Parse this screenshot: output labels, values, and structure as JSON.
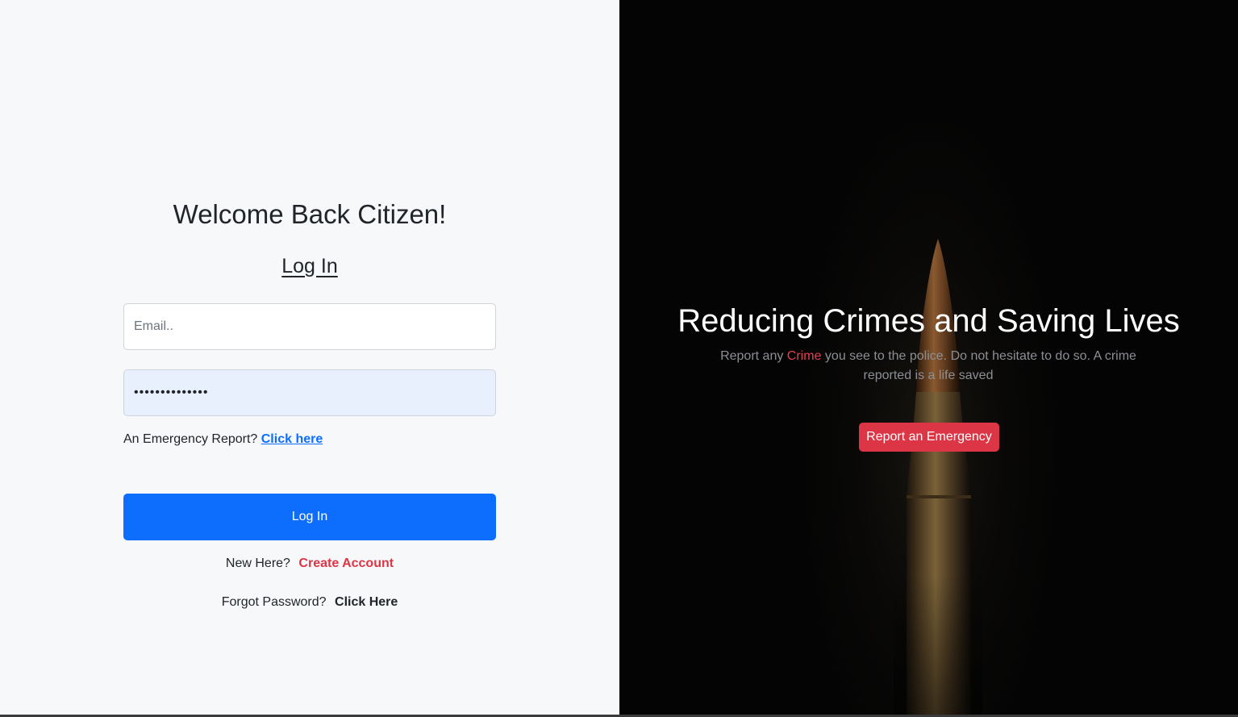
{
  "login": {
    "welcome": "Welcome Back Citizen!",
    "title": "Log In",
    "email_placeholder": "Email..",
    "password_value": "••••••••••••••",
    "emergency_prompt": "An Emergency Report? ",
    "emergency_link": "Click here",
    "submit_label": "Log In",
    "new_prompt": "New Here?",
    "create_link": "Create Account",
    "forgot_prompt": "Forgot Password?",
    "forgot_link": "Click Here"
  },
  "hero": {
    "title": "Reducing Crimes and Saving Lives",
    "text_before": "Report any ",
    "text_highlight": "Crime",
    "text_after": " you see to the police. Do not hesitate to do so. A crime reported is a life saved",
    "button_label": "Report an Emergency",
    "background_image": "bullet-icon"
  },
  "colors": {
    "primary": "#0d6efd",
    "danger": "#dc3545",
    "left_background": "#f7f8fa",
    "right_background": "#040404"
  }
}
